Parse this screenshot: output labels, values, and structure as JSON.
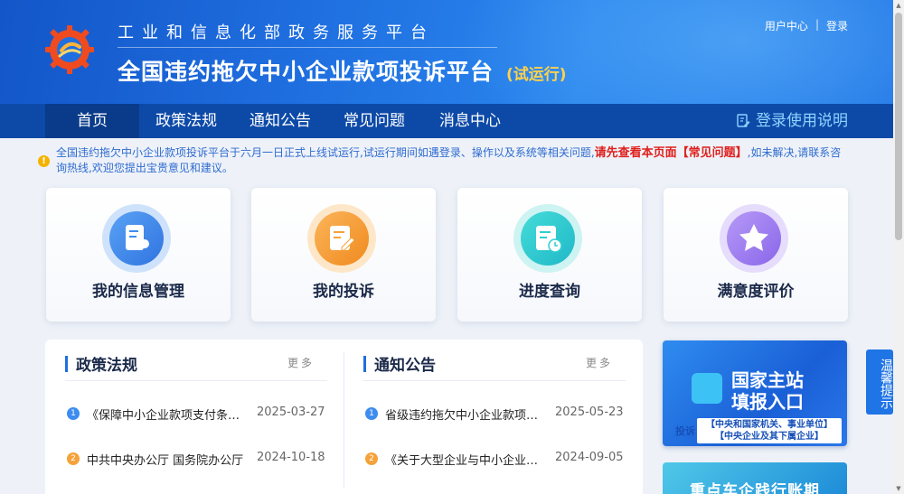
{
  "header": {
    "subtitle": "工业和信息化部政务服务平台",
    "title": "全国违约拖欠中小企业款项投诉平台",
    "title_tag": "(试运行)",
    "links": [
      "用户中心",
      "登录"
    ],
    "link_sep": "|"
  },
  "nav": {
    "items": [
      "首页",
      "政策法规",
      "通知公告",
      "常见问题",
      "消息中心"
    ],
    "active": "首页",
    "right_label": "登录使用说明"
  },
  "notice": {
    "icon": "!",
    "text_before": "全国违约拖欠中小企业款项投诉平台于六月一日正式上线试运行,试运行期间如遇登录、操作以及系统等相关问题,",
    "highlight": "请先查看本页面【常见问题】",
    "text_after": ",如未解决,请联系咨询热线,欢迎您提出宝贵意见和建议。"
  },
  "cards": [
    {
      "label": "我的信息管理",
      "color": "#3d8cf0",
      "ring": "#cfe2fb",
      "icon": "profile-icon"
    },
    {
      "label": "我的投诉",
      "color": "#f5a23a",
      "ring": "#fde7c8",
      "icon": "edit-icon"
    },
    {
      "label": "进度查询",
      "color": "#2fcfd0",
      "ring": "#cdf3f3",
      "icon": "schedule-icon"
    },
    {
      "label": "满意度评价",
      "color": "#9a7cf0",
      "ring": "#e6dcfc",
      "icon": "star-icon"
    }
  ],
  "policy": {
    "title": "政策法规",
    "more": "更多",
    "items": [
      {
        "num": "1",
        "text": "《保障中小企业款项支付条例》",
        "date": "2025-03-27"
      },
      {
        "num": "2",
        "text": "中共中央办公厅 国务院办公厅",
        "date": "2024-10-18"
      }
    ]
  },
  "notices": {
    "title": "通知公告",
    "more": "更多",
    "items": [
      {
        "num": "1",
        "text": "省级违约拖欠中小企业款项投诉",
        "date": "2025-05-23"
      },
      {
        "num": "2",
        "text": "《关于大型企业与中小企业签订",
        "date": "2024-09-05"
      }
    ]
  },
  "banner1": {
    "title_line1": "国家主站",
    "title_line2": "填报入口",
    "tag": "投诉",
    "line1": "【中央和国家机关、事业单位】",
    "line2": "【中央企业及其下属企业】"
  },
  "banner2": {
    "title": "重点车企践行账期"
  },
  "side_tab": {
    "label": "温馨提示"
  },
  "colors": {
    "num_blue": "#3d8cf0",
    "num_orange": "#f5a23a"
  }
}
